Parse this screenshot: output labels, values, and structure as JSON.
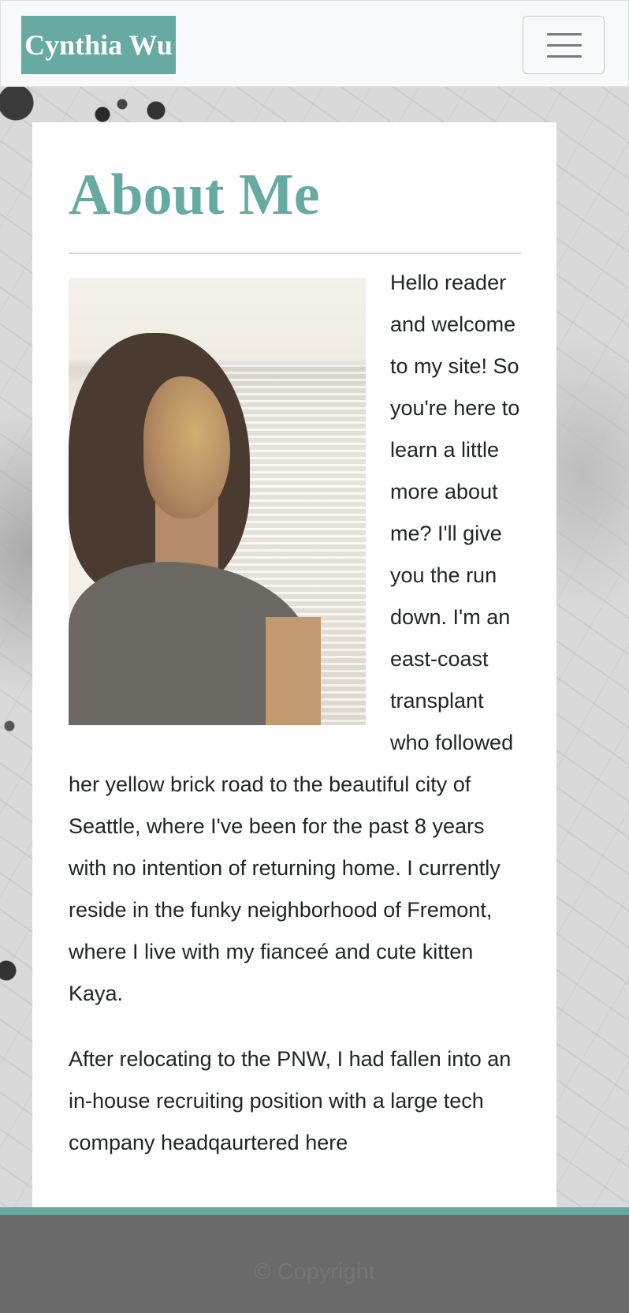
{
  "navbar": {
    "brand": "Cynthia Wu",
    "toggle_icon": "hamburger-menu-icon"
  },
  "main": {
    "title": "About Me",
    "image": {
      "description_icon": "portrait-photo"
    },
    "paragraphs": [
      "Hello reader and welcome to my site! So you're here to learn a little more about me? I'll give you the run down. I'm an east-coast transplant who followed her yellow brick road to the beautiful city of Seattle, where I've been for the past 8 years with no intention of returning home. I currently reside in the funky neighborhood of Fremont, where I live with my fianceé and cute kitten Kaya.",
      "After relocating to the PNW, I had fallen into an in-house recruiting position with a large tech company headqaurtered here"
    ]
  },
  "footer": {
    "copyright": "© Copyright"
  },
  "colors": {
    "accent": "#67aaa1",
    "navbar_bg": "#f8f9fa",
    "footer_bg": "#6a6a6a",
    "text": "#212529"
  }
}
